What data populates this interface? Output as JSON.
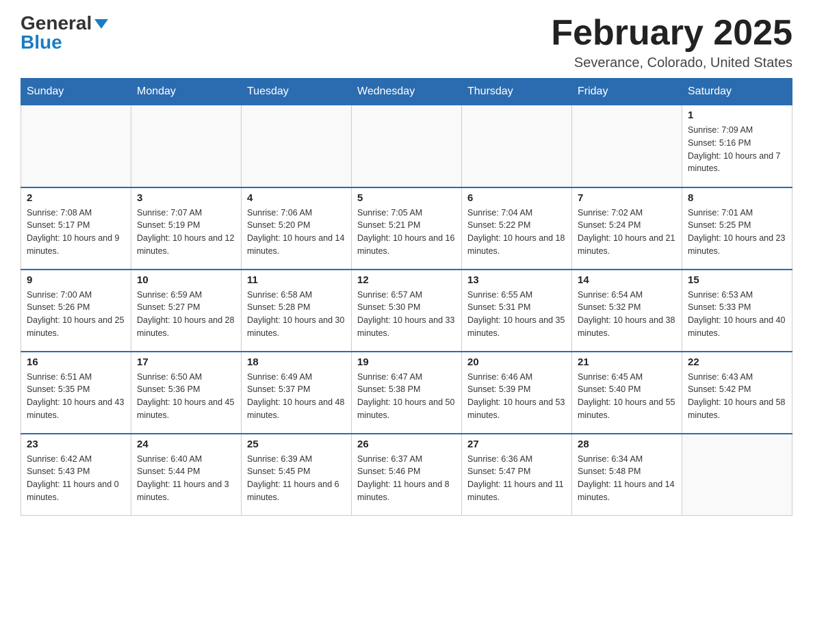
{
  "logo": {
    "general": "General",
    "blue": "Blue"
  },
  "title": "February 2025",
  "location": "Severance, Colorado, United States",
  "days_of_week": [
    "Sunday",
    "Monday",
    "Tuesday",
    "Wednesday",
    "Thursday",
    "Friday",
    "Saturday"
  ],
  "weeks": [
    [
      {
        "day": "",
        "info": ""
      },
      {
        "day": "",
        "info": ""
      },
      {
        "day": "",
        "info": ""
      },
      {
        "day": "",
        "info": ""
      },
      {
        "day": "",
        "info": ""
      },
      {
        "day": "",
        "info": ""
      },
      {
        "day": "1",
        "info": "Sunrise: 7:09 AM\nSunset: 5:16 PM\nDaylight: 10 hours and 7 minutes."
      }
    ],
    [
      {
        "day": "2",
        "info": "Sunrise: 7:08 AM\nSunset: 5:17 PM\nDaylight: 10 hours and 9 minutes."
      },
      {
        "day": "3",
        "info": "Sunrise: 7:07 AM\nSunset: 5:19 PM\nDaylight: 10 hours and 12 minutes."
      },
      {
        "day": "4",
        "info": "Sunrise: 7:06 AM\nSunset: 5:20 PM\nDaylight: 10 hours and 14 minutes."
      },
      {
        "day": "5",
        "info": "Sunrise: 7:05 AM\nSunset: 5:21 PM\nDaylight: 10 hours and 16 minutes."
      },
      {
        "day": "6",
        "info": "Sunrise: 7:04 AM\nSunset: 5:22 PM\nDaylight: 10 hours and 18 minutes."
      },
      {
        "day": "7",
        "info": "Sunrise: 7:02 AM\nSunset: 5:24 PM\nDaylight: 10 hours and 21 minutes."
      },
      {
        "day": "8",
        "info": "Sunrise: 7:01 AM\nSunset: 5:25 PM\nDaylight: 10 hours and 23 minutes."
      }
    ],
    [
      {
        "day": "9",
        "info": "Sunrise: 7:00 AM\nSunset: 5:26 PM\nDaylight: 10 hours and 25 minutes."
      },
      {
        "day": "10",
        "info": "Sunrise: 6:59 AM\nSunset: 5:27 PM\nDaylight: 10 hours and 28 minutes."
      },
      {
        "day": "11",
        "info": "Sunrise: 6:58 AM\nSunset: 5:28 PM\nDaylight: 10 hours and 30 minutes."
      },
      {
        "day": "12",
        "info": "Sunrise: 6:57 AM\nSunset: 5:30 PM\nDaylight: 10 hours and 33 minutes."
      },
      {
        "day": "13",
        "info": "Sunrise: 6:55 AM\nSunset: 5:31 PM\nDaylight: 10 hours and 35 minutes."
      },
      {
        "day": "14",
        "info": "Sunrise: 6:54 AM\nSunset: 5:32 PM\nDaylight: 10 hours and 38 minutes."
      },
      {
        "day": "15",
        "info": "Sunrise: 6:53 AM\nSunset: 5:33 PM\nDaylight: 10 hours and 40 minutes."
      }
    ],
    [
      {
        "day": "16",
        "info": "Sunrise: 6:51 AM\nSunset: 5:35 PM\nDaylight: 10 hours and 43 minutes."
      },
      {
        "day": "17",
        "info": "Sunrise: 6:50 AM\nSunset: 5:36 PM\nDaylight: 10 hours and 45 minutes."
      },
      {
        "day": "18",
        "info": "Sunrise: 6:49 AM\nSunset: 5:37 PM\nDaylight: 10 hours and 48 minutes."
      },
      {
        "day": "19",
        "info": "Sunrise: 6:47 AM\nSunset: 5:38 PM\nDaylight: 10 hours and 50 minutes."
      },
      {
        "day": "20",
        "info": "Sunrise: 6:46 AM\nSunset: 5:39 PM\nDaylight: 10 hours and 53 minutes."
      },
      {
        "day": "21",
        "info": "Sunrise: 6:45 AM\nSunset: 5:40 PM\nDaylight: 10 hours and 55 minutes."
      },
      {
        "day": "22",
        "info": "Sunrise: 6:43 AM\nSunset: 5:42 PM\nDaylight: 10 hours and 58 minutes."
      }
    ],
    [
      {
        "day": "23",
        "info": "Sunrise: 6:42 AM\nSunset: 5:43 PM\nDaylight: 11 hours and 0 minutes."
      },
      {
        "day": "24",
        "info": "Sunrise: 6:40 AM\nSunset: 5:44 PM\nDaylight: 11 hours and 3 minutes."
      },
      {
        "day": "25",
        "info": "Sunrise: 6:39 AM\nSunset: 5:45 PM\nDaylight: 11 hours and 6 minutes."
      },
      {
        "day": "26",
        "info": "Sunrise: 6:37 AM\nSunset: 5:46 PM\nDaylight: 11 hours and 8 minutes."
      },
      {
        "day": "27",
        "info": "Sunrise: 6:36 AM\nSunset: 5:47 PM\nDaylight: 11 hours and 11 minutes."
      },
      {
        "day": "28",
        "info": "Sunrise: 6:34 AM\nSunset: 5:48 PM\nDaylight: 11 hours and 14 minutes."
      },
      {
        "day": "",
        "info": ""
      }
    ]
  ]
}
